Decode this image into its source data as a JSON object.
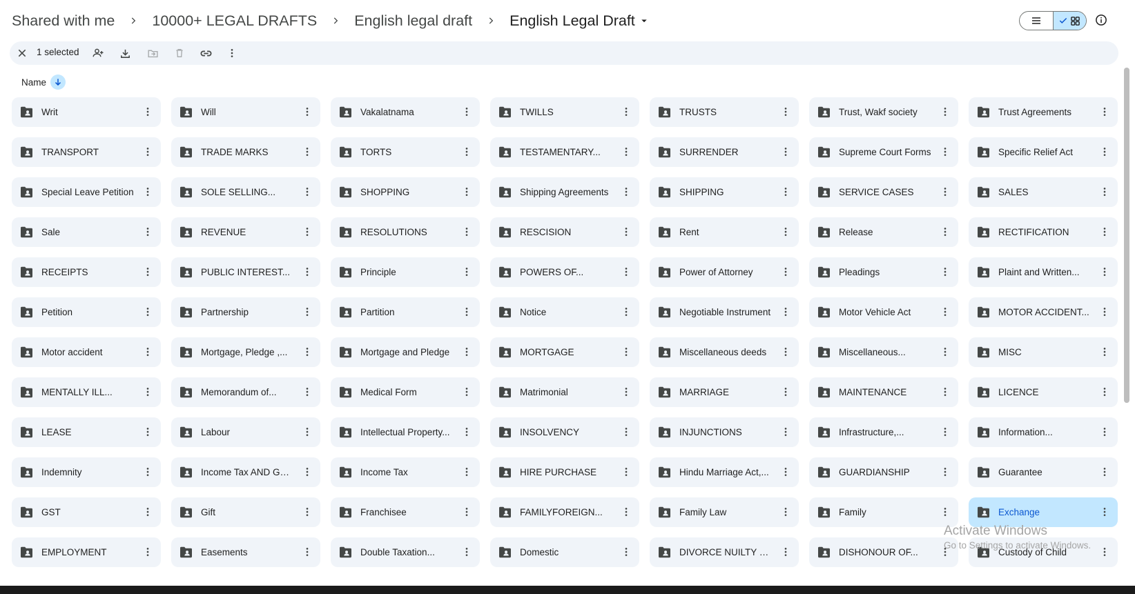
{
  "breadcrumb": {
    "items": [
      "Shared with me",
      "10000+ LEGAL DRAFTS",
      "English legal draft"
    ],
    "current": "English Legal Draft"
  },
  "selection": {
    "count_label": "1 selected"
  },
  "sort": {
    "label": "Name"
  },
  "folders": [
    "Writ",
    "Will",
    "Vakalatnama",
    "TWILLS",
    "TRUSTS",
    "Trust, Wakf society",
    "Trust Agreements",
    "TRANSPORT",
    "TRADE MARKS",
    "TORTS",
    "TESTAMENTARY...",
    "SURRENDER",
    "Supreme Court Forms",
    "Specific Relief Act",
    "Special Leave Petition",
    "SOLE SELLING...",
    "SHOPPING",
    "Shipping Agreements",
    "SHIPPING",
    "SERVICE CASES",
    "SALES",
    "Sale",
    "REVENUE",
    "RESOLUTIONS",
    "RESCISION",
    "Rent",
    "Release",
    "RECTIFICATION",
    "RECEIPTS",
    "PUBLIC INTEREST...",
    "Principle",
    "POWERS OF...",
    "Power of Attorney",
    "Pleadings",
    "Plaint and Written...",
    "Petition",
    "Partnership",
    "Partition",
    "Notice",
    "Negotiable Instrument",
    "Motor Vehicle Act",
    "MOTOR ACCIDENT...",
    "Motor accident",
    "Mortgage, Pledge ,...",
    "Mortgage and Pledge",
    "MORTGAGE",
    "Miscellaneous deeds",
    "Miscellaneous...",
    "MISC",
    "MENTALLY ILL...",
    "Memorandum of...",
    "Medical Form",
    "Matrimonial",
    "MARRIAGE",
    "MAINTENANCE",
    "LICENCE",
    "LEASE",
    "Labour",
    "Intellectual Property...",
    "INSOLVENCY",
    "INJUNCTIONS",
    "Infrastructure,...",
    "Information...",
    "Indemnity",
    "Income Tax AND GST...",
    "Income Tax",
    "HIRE PURCHASE",
    "Hindu Marriage Act,...",
    "GUARDIANSHIP",
    "Guarantee",
    "GST",
    "Gift",
    "Franchisee",
    "FAMILYFOREIGN...",
    "Family Law",
    "Family",
    "Exchange",
    "EMPLOYMENT",
    "Easements",
    "Double Taxation...",
    "Domestic",
    "DIVORCE NUILTY OF...",
    "DISHONOUR OF...",
    "Custody of Child"
  ],
  "selected_folder": "Exchange",
  "watermark": {
    "line1": "Activate Windows",
    "line2": "Go to Settings to activate Windows."
  },
  "colors": {
    "tile": "#f0f4f9",
    "tile_selected": "#c2e7ff",
    "selected_text": "#0b57d0"
  },
  "icons": {
    "close": "close-icon",
    "share": "add-person-icon",
    "download": "download-icon",
    "move": "move-folder-icon",
    "trash": "trash-icon",
    "link": "link-icon",
    "more": "more-vert-icon",
    "folder": "shared-folder-icon",
    "sort": "arrow-down-icon",
    "list": "list-icon",
    "grid": "grid-icon",
    "info": "info-icon"
  }
}
